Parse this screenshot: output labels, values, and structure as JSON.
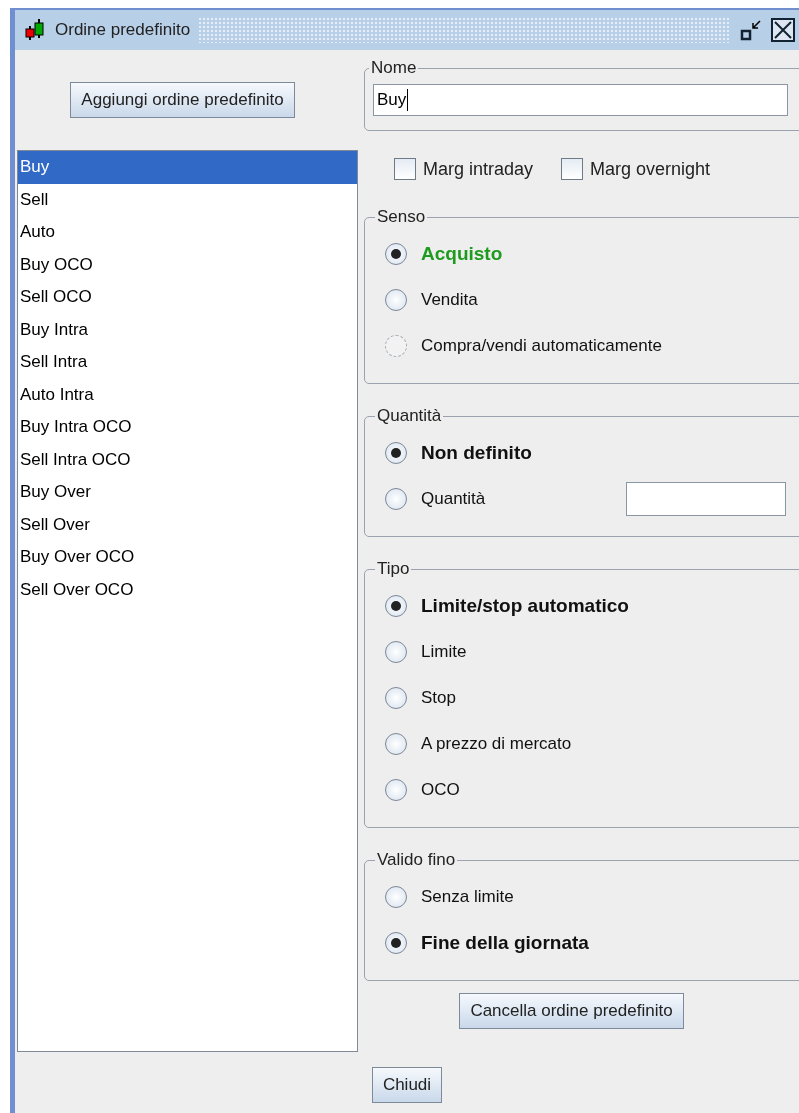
{
  "window": {
    "title": "Ordine predefinito"
  },
  "add_button": "Aggiungi ordine predefinito",
  "orders": [
    {
      "label": "Buy",
      "selected": true
    },
    {
      "label": "Sell",
      "selected": false
    },
    {
      "label": "Auto",
      "selected": false
    },
    {
      "label": "Buy OCO",
      "selected": false
    },
    {
      "label": "Sell OCO",
      "selected": false
    },
    {
      "label": "Buy Intra",
      "selected": false
    },
    {
      "label": "Sell Intra",
      "selected": false
    },
    {
      "label": "Auto Intra",
      "selected": false
    },
    {
      "label": "Buy Intra OCO",
      "selected": false
    },
    {
      "label": "Sell Intra OCO",
      "selected": false
    },
    {
      "label": "Buy Over",
      "selected": false
    },
    {
      "label": "Sell Over",
      "selected": false
    },
    {
      "label": "Buy Over OCO",
      "selected": false
    },
    {
      "label": "Sell Over OCO",
      "selected": false
    }
  ],
  "name_group": {
    "legend": "Nome",
    "value": "Buy"
  },
  "checkboxes": [
    {
      "label": "Marg intraday",
      "checked": false
    },
    {
      "label": "Marg overnight",
      "checked": false
    }
  ],
  "groups": [
    {
      "legend": "Senso",
      "options": [
        {
          "label": "Acquisto",
          "selected": true,
          "disabled": false,
          "color": "#1e9a1e"
        },
        {
          "label": "Vendita",
          "selected": false,
          "disabled": false
        },
        {
          "label": "Compra/vendi automaticamente",
          "selected": false,
          "disabled": true
        }
      ]
    },
    {
      "legend": "Quantità",
      "options": [
        {
          "label": "Non definito",
          "selected": true,
          "disabled": false
        },
        {
          "label": "Quantità",
          "selected": false,
          "disabled": false,
          "kind": "with-field"
        }
      ]
    },
    {
      "legend": "Tipo",
      "options": [
        {
          "label": "Limite/stop automatico",
          "selected": true,
          "disabled": false
        },
        {
          "label": "Limite",
          "selected": false,
          "disabled": false
        },
        {
          "label": "Stop",
          "selected": false,
          "disabled": false
        },
        {
          "label": "A prezzo di mercato",
          "selected": false,
          "disabled": false
        },
        {
          "label": "OCO",
          "selected": false,
          "disabled": false
        }
      ]
    },
    {
      "legend": "Valido fino",
      "options": [
        {
          "label": "Senza limite",
          "selected": false,
          "disabled": false
        },
        {
          "label": "Fine della giornata",
          "selected": true,
          "disabled": false
        }
      ]
    }
  ],
  "delete_button": "Cancella ordine predefinito",
  "close_button": "Chiudi"
}
